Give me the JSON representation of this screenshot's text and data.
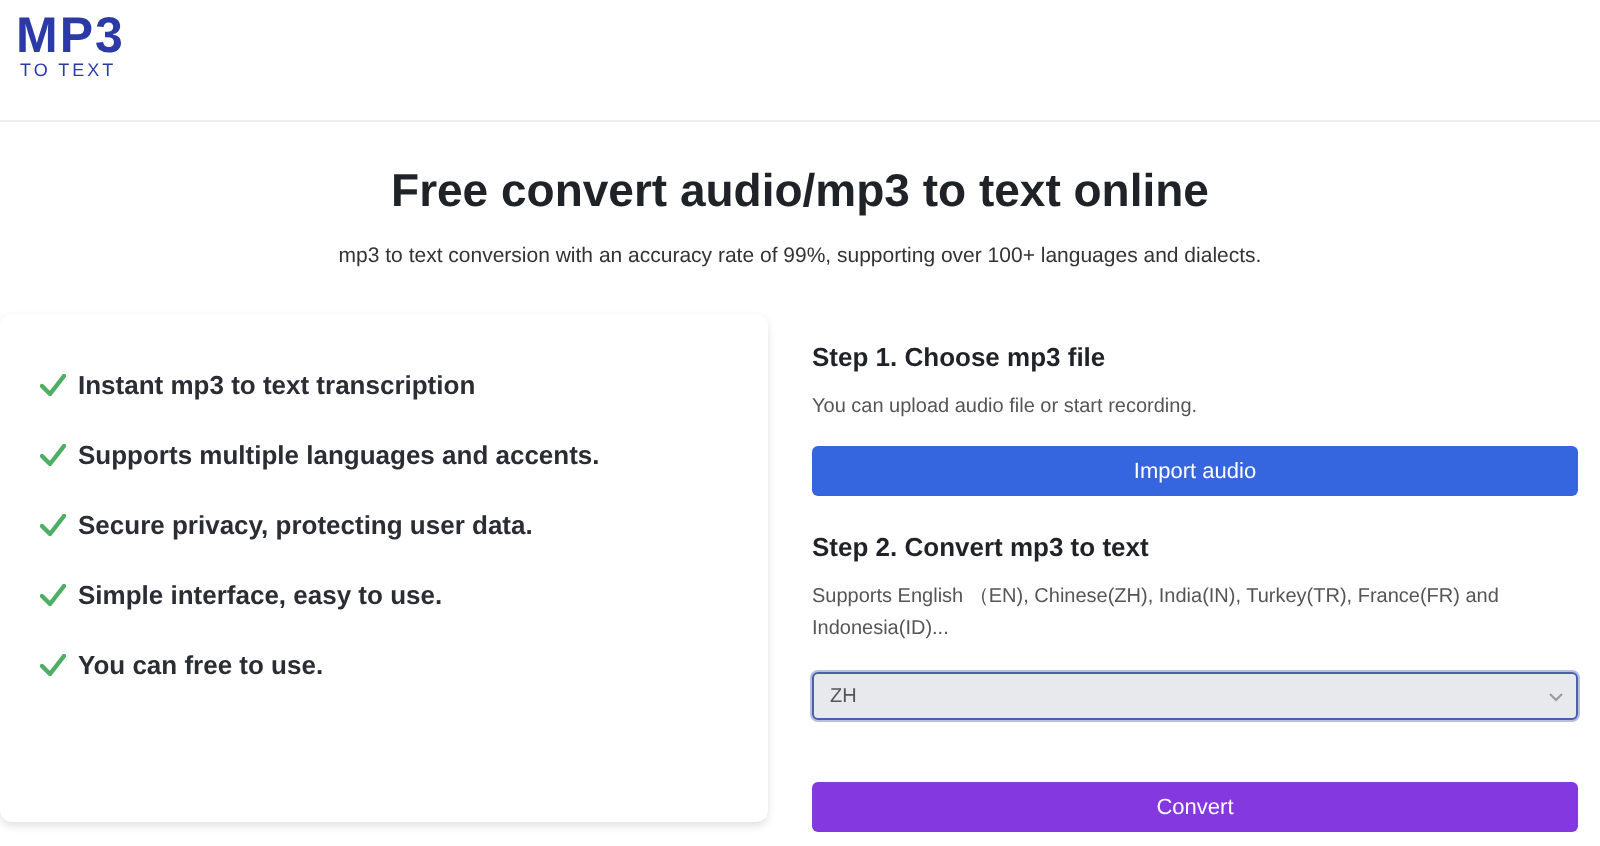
{
  "logo": {
    "main": "MP3",
    "sub": "TO TEXT"
  },
  "hero": {
    "title": "Free convert audio/mp3 to text online",
    "subtitle": "mp3 to text conversion with an accuracy rate of 99%, supporting over 100+ languages and dialects."
  },
  "features": [
    "Instant mp3 to text transcription",
    "Supports multiple languages and accents.",
    "Secure privacy, protecting user data.",
    "Simple interface, easy to use.",
    "You can free to use."
  ],
  "step1": {
    "heading": "Step 1. Choose mp3 file",
    "note": "You can upload audio file or start recording.",
    "button": "Import audio"
  },
  "step2": {
    "heading": "Step 2. Convert mp3 to text",
    "note": "Supports English （EN), Chinese(ZH), India(IN), Turkey(TR), France(FR) and Indonesia(ID)...",
    "language": {
      "value": "ZH",
      "focused": true
    },
    "button": "Convert"
  }
}
